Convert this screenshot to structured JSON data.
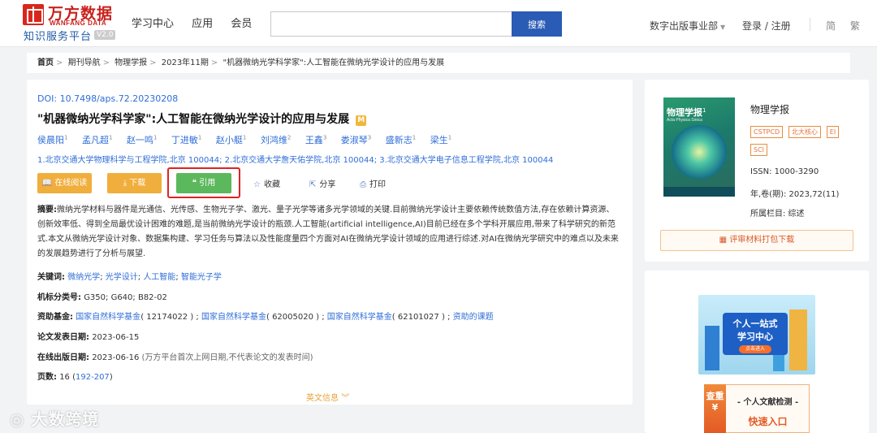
{
  "header": {
    "logo_cn": "万方数据",
    "logo_en": "WANFANG DATA",
    "logo_sub": "知识服务平台",
    "logo_ver": "V2.0",
    "nav": [
      "学习中心",
      "应用",
      "会员"
    ],
    "search_placeholder": "",
    "search_btn": "搜索",
    "dept": "数字出版事业部",
    "login": "登录 / 注册",
    "lang_simple": "简",
    "lang_trad": "繁"
  },
  "breadcrumb": [
    "首页",
    "期刊导航",
    "物理学报",
    "2023年11期",
    "\"机器微纳光学科学家\":人工智能在微纳光学设计的应用与发展"
  ],
  "article": {
    "doi": "DOI: 10.7498/aps.72.20230208",
    "title": "\"机器微纳光学科学家\":人工智能在微纳光学设计的应用与发展",
    "title_badge": "M",
    "authors": [
      {
        "name": "侯晨阳",
        "sup": "1"
      },
      {
        "name": "孟凡超",
        "sup": "1"
      },
      {
        "name": "赵一鸣",
        "sup": "1"
      },
      {
        "name": "丁进敏",
        "sup": "1"
      },
      {
        "name": "赵小艇",
        "sup": "1"
      },
      {
        "name": "刘鸿维",
        "sup": "2"
      },
      {
        "name": "王鑫",
        "sup": "3"
      },
      {
        "name": "娄淑琴",
        "sup": "3"
      },
      {
        "name": "盛新志",
        "sup": "1"
      },
      {
        "name": "梁生",
        "sup": "1"
      }
    ],
    "affiliations": "1.北京交通大学物理科学与工程学院,北京 100044; 2.北京交通大学詹天佑学院,北京 100044; 3.北京交通大学电子信息工程学院,北京 100044",
    "actions": {
      "read": "在线阅读",
      "download": "下载",
      "cite": "引用",
      "favorite": "收藏",
      "share": "分享",
      "print": "打印"
    },
    "abstract_label": "摘要:",
    "abstract": "微纳光学材料与器件是光通信、光传感、生物光子学、激光、量子光学等诸多光学领域的关键.目前微纳光学设计主要依赖传统数值方法,存在依赖计算资源、创新效率低、得到全局最优设计困难的难题,是当前微纳光学设计的瓶颈.人工智能(artificial intelligence,AI)目前已经在多个学科开展应用,带来了科学研究的新范式.本文从微纳光学设计对象、数据集构建、学习任务与算法以及性能度量四个方面对AI在微纳光学设计领域的应用进行综述.对AI在微纳光学研究中的难点以及未来的发展趋势进行了分析与展望.",
    "keywords_label": "关键词:",
    "keywords": [
      "微纳光学",
      "光学设计",
      "人工智能",
      "智能光子学"
    ],
    "clc_label": "机标分类号:",
    "clc": "G350; G640; B82-02",
    "funds_label": "资助基金:",
    "funds": [
      {
        "name": "国家自然科学基金",
        "code": "( 12174022 )"
      },
      {
        "name": "国家自然科学基金",
        "code": "( 62005020 )"
      },
      {
        "name": "国家自然科学基金",
        "code": "( 62101027 )"
      }
    ],
    "funds_extra": "资助的课题",
    "pubdate_label": "论文发表日期:",
    "pubdate": "2023-06-15",
    "onlinedate_label": "在线出版日期:",
    "onlinedate": "2023-06-16",
    "onlinedate_note": "(万方平台首次上网日期,不代表论文的发表时间)",
    "pages_label": "页数:",
    "pages_count": "16",
    "pages_range": "192-207",
    "more": "英文信息"
  },
  "journal": {
    "cover_title": "物理学报",
    "cover_en": "Acta Physica Sinica",
    "cover_num": "1",
    "name": "物理学报",
    "tags": [
      "CSTPCD",
      "北大核心",
      "EI",
      "SCI"
    ],
    "issn": "ISSN:  1000-3290",
    "year_vol": "年,卷(期):  2023,72(11)",
    "column": "所属栏目:  综述",
    "pkg_btn": "评审材料打包下载"
  },
  "promo": {
    "line1": "个人一站式",
    "line2": "学习中心",
    "btn": "点击进入",
    "tab": "查重",
    "check_title": "- 个人文献检测 -",
    "check_entry": "快速入口"
  },
  "watermark": "大数跨境"
}
